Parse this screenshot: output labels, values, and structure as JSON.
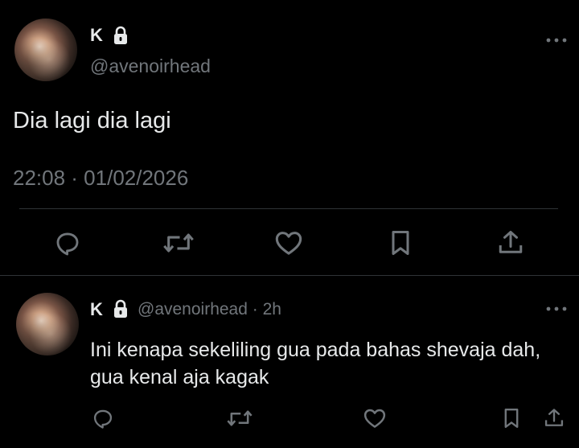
{
  "main_tweet": {
    "display_name": "K",
    "handle": "@avenoirhead",
    "text": "Dia lagi dia lagi",
    "timestamp": "22:08 · 01/02/2026"
  },
  "reply_tweet": {
    "display_name": "K",
    "handle": "@avenoirhead",
    "separator": "·",
    "time_ago": "2h",
    "text": "Ini kenapa sekeliling gua pada bahas shevaja dah, gua kenal aja kagak"
  },
  "icons": {
    "more": "more-horizontal-icon",
    "lock": "lock-icon",
    "reply": "reply-bubble-icon",
    "retweet": "retweet-icon",
    "like": "heart-icon",
    "bookmark": "bookmark-icon",
    "share": "share-upload-icon"
  },
  "colors": {
    "background": "#000000",
    "text": "#e7e9ea",
    "muted": "#71767b",
    "divider": "#2f3336"
  }
}
